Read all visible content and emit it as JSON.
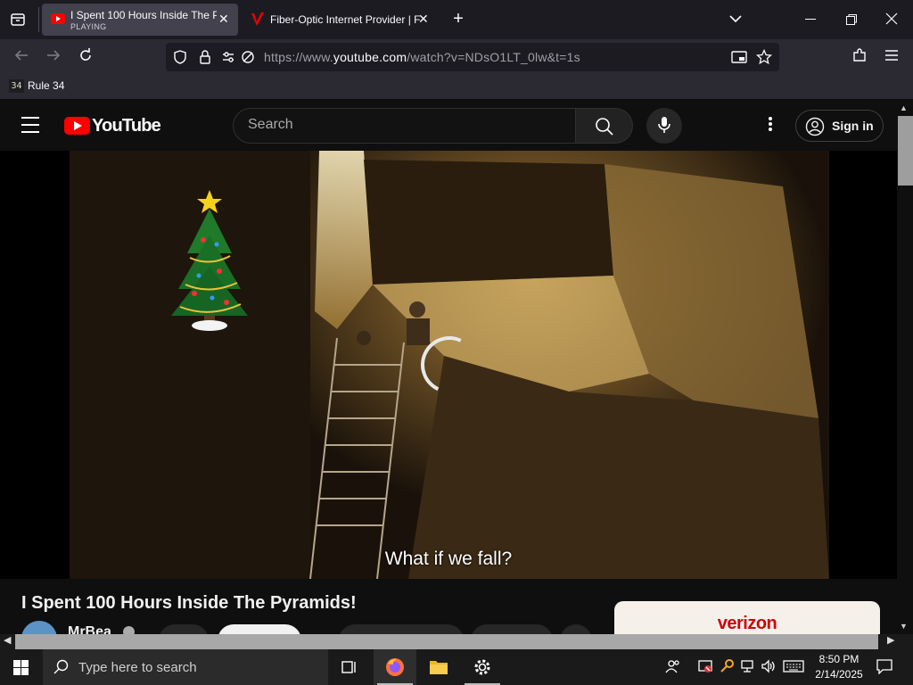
{
  "browser": {
    "tabs": [
      {
        "title": "I Spent 100 Hours Inside The Py",
        "status": "PLAYING"
      },
      {
        "title": "Fiber-Optic Internet Provider | F"
      }
    ],
    "url_prefix": "https://www.",
    "url_domain": "youtube.com",
    "url_path": "/watch?v=NDsO1LT_0lw&t=1s",
    "bookmark": {
      "icon_text": "34",
      "label": "Rule 34"
    }
  },
  "youtube": {
    "logo_text": "YouTube",
    "search_placeholder": "Search",
    "signin_label": "Sign in",
    "caption": "What if we fall?",
    "video_title": "I Spent 100 Hours Inside The Pyramids!",
    "channel_name": "MrBea",
    "ad_brand": "verizon"
  },
  "taskbar": {
    "search_placeholder": "Type here to search",
    "time": "8:50 PM",
    "date": "2/14/2025"
  },
  "colors": {
    "yt_red": "#ff0000",
    "verizon_red": "#cd040b",
    "firefox_tabbar": "#1c1b22",
    "firefox_toolbar": "#2b2a33"
  }
}
